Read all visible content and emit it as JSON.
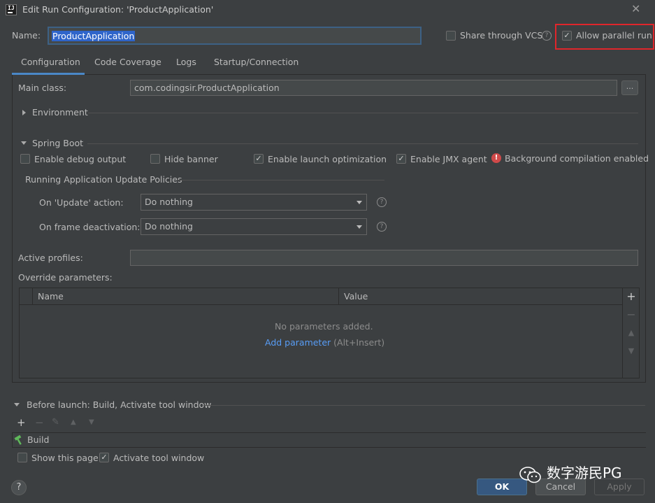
{
  "window": {
    "title": "Edit Run Configuration: 'ProductApplication'",
    "close_glyph": "✕"
  },
  "name_row": {
    "label": "Name:",
    "value": "ProductApplication",
    "share_label": "Share through VCS",
    "share_checked": false,
    "parallel_label": "Allow parallel run",
    "parallel_checked": true
  },
  "tabs": [
    {
      "label": "Configuration",
      "active": true
    },
    {
      "label": "Code Coverage",
      "active": false
    },
    {
      "label": "Logs",
      "active": false
    },
    {
      "label": "Startup/Connection",
      "active": false
    }
  ],
  "config": {
    "main_class_label": "Main class:",
    "main_class_value": "com.codingsir.ProductApplication",
    "browse_label": "...",
    "environment_label": "Environment",
    "spring_boot_label": "Spring Boot",
    "options": [
      {
        "label": "Enable debug output",
        "checked": false
      },
      {
        "label": "Hide banner",
        "checked": false
      },
      {
        "label": "Enable launch optimization",
        "checked": true
      },
      {
        "label": "Enable JMX agent",
        "checked": true
      }
    ],
    "bg_compilation_label": "Background compilation enabled",
    "policies_label": "Running Application Update Policies",
    "update_action_label": "On 'Update' action:",
    "update_action_value": "Do nothing",
    "frame_deactivation_label": "On frame deactivation:",
    "frame_deactivation_value": "Do nothing",
    "active_profiles_label": "Active profiles:",
    "active_profiles_value": "",
    "override_label": "Override parameters:",
    "table": {
      "columns": [
        "Name",
        "Value"
      ],
      "empty_text": "No parameters added.",
      "add_link": "Add parameter",
      "add_shortcut": "(Alt+Insert)"
    }
  },
  "before_launch": {
    "label": "Before launch: Build, Activate tool window",
    "tasks": [
      "Build"
    ],
    "show_page_label": "Show this page",
    "show_page_checked": false,
    "activate_label": "Activate tool window",
    "activate_checked": true
  },
  "buttons": {
    "ok": "OK",
    "cancel": "Cancel",
    "apply": "Apply",
    "help": "?"
  },
  "watermark": "数字游民PG",
  "colors": {
    "background": "#3c3f41",
    "accent": "#4a88c7",
    "highlight_border": "#e0262b",
    "link": "#589df6"
  }
}
